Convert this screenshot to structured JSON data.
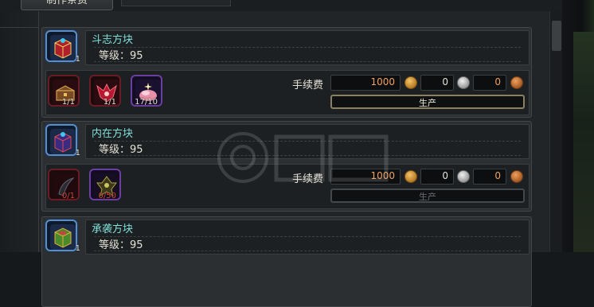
{
  "tab": {
    "label": "制作条费"
  },
  "cards": [
    {
      "name": "斗志方块",
      "level": "等级：95",
      "count": "1",
      "materials": [
        {
          "count": "1/1",
          "lack": false,
          "icon": "chest-icon"
        },
        {
          "count": "1/1",
          "lack": false,
          "icon": "dragon-armor-icon"
        },
        {
          "count": "17/10",
          "lack": false,
          "icon": "pink-crystal-icon"
        }
      ],
      "fee_label": "手续费",
      "gold": "1000",
      "silver": "0",
      "bronze": "0",
      "produce": "生产",
      "produce_enabled": true
    },
    {
      "name": "内在方块",
      "level": "等级：95",
      "count": "1",
      "materials": [
        {
          "count": "0/1",
          "lack": true,
          "icon": "dark-claw-icon"
        },
        {
          "count": "0/50",
          "lack": true,
          "icon": "dark-crest-icon"
        }
      ],
      "fee_label": "手续费",
      "gold": "1000",
      "silver": "0",
      "bronze": "0",
      "produce": "生产",
      "produce_enabled": false
    },
    {
      "name": "承袭方块",
      "level": "等级：95",
      "count": "1"
    }
  ],
  "colors": {
    "name": "#7fe0d8",
    "gold_value": "#f0a060",
    "lack": "#d24a3a"
  }
}
